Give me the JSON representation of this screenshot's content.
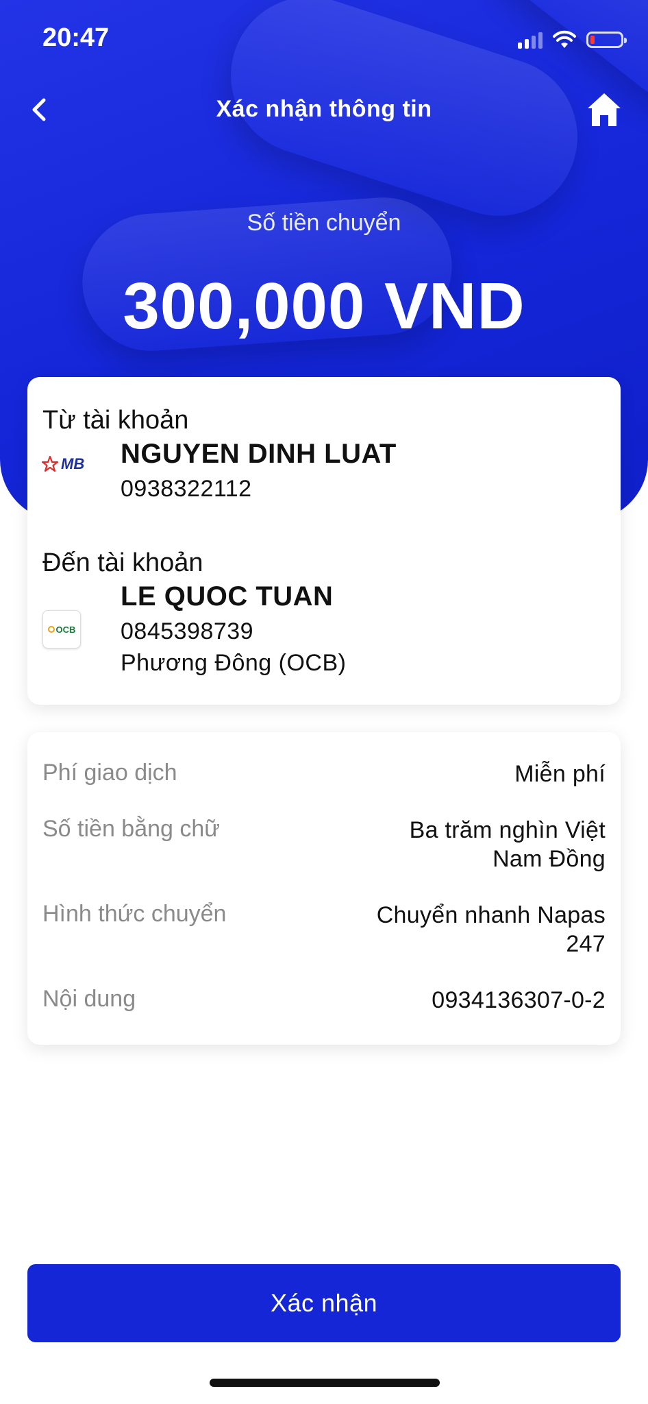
{
  "status_bar": {
    "time": "20:47"
  },
  "header": {
    "title": "Xác nhận thông tin"
  },
  "amount": {
    "label": "Số tiền chuyển",
    "value": "300,000 VND"
  },
  "from_account": {
    "section_label": "Từ tài khoản",
    "bank_logo_text": "MB",
    "name": "NGUYEN DINH LUAT",
    "number": "0938322112"
  },
  "to_account": {
    "section_label": "Đến tài khoản",
    "bank_logo_text": "OCB",
    "name": "LE QUOC TUAN",
    "number": "0845398739",
    "bank_name": "Phương Đông (OCB)"
  },
  "details": [
    {
      "label": "Phí giao dịch",
      "value": "Miễn phí"
    },
    {
      "label": "Số tiền bằng chữ",
      "value_line1": "Ba trăm nghìn Việt",
      "value_line2": "Nam Đồng"
    },
    {
      "label": "Hình thức chuyển",
      "value_line1": "Chuyển nhanh Napas",
      "value_line2": "247"
    },
    {
      "label": "Nội dung",
      "value": "0934136307-0-2"
    }
  ],
  "confirm_button": {
    "label": "Xác nhận"
  },
  "colors": {
    "primary": "#1426d6",
    "hero": "#1e30e0",
    "muted_text": "#8a8a8a"
  },
  "icons": {
    "back": "chevron-left-icon",
    "home": "home-icon",
    "signal": "cellular-signal-icon",
    "wifi": "wifi-icon",
    "battery": "battery-low-icon"
  }
}
